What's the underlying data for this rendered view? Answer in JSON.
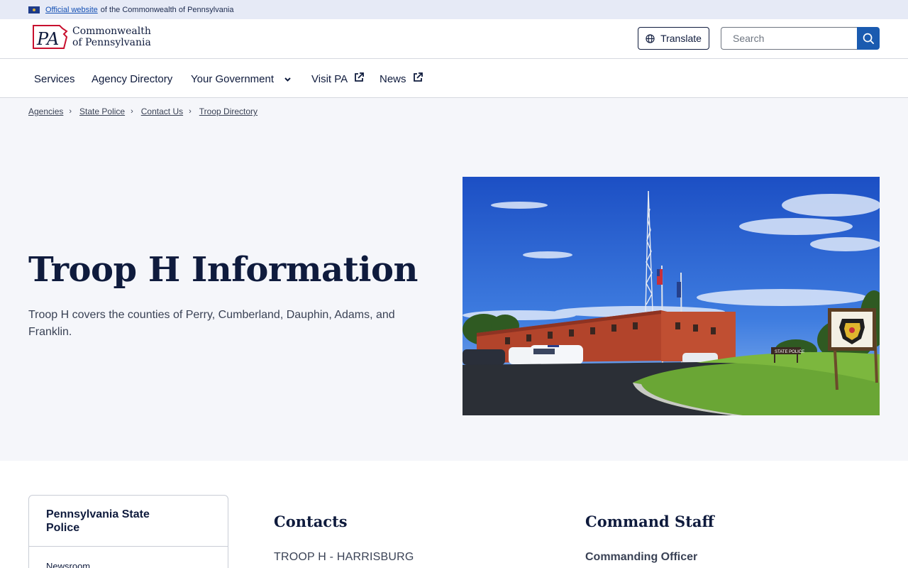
{
  "official_banner": {
    "link_text": "Official website",
    "rest_text": "of the Commonwealth of Pennsylvania"
  },
  "header": {
    "logo_mark": "PA",
    "logo_line1": "Commonwealth",
    "logo_line2": "of Pennsylvania",
    "translate_label": "Translate",
    "search_placeholder": "Search"
  },
  "nav": {
    "items": [
      {
        "label": "Services",
        "external": false,
        "dropdown": false
      },
      {
        "label": "Agency Directory",
        "external": false,
        "dropdown": false
      },
      {
        "label": "Your Government",
        "external": false,
        "dropdown": true
      },
      {
        "label": "Visit PA",
        "external": true,
        "dropdown": false
      },
      {
        "label": "News",
        "external": true,
        "dropdown": false
      }
    ]
  },
  "breadcrumb": [
    "Agencies",
    "State Police",
    "Contact Us",
    "Troop Directory"
  ],
  "hero": {
    "title": "Troop H Information",
    "description": "Troop H covers the counties of Perry, Cumberland, Dauphin, Adams, and Franklin.",
    "image_sign_label": "STATE POLICE"
  },
  "sidebar": {
    "title": "Pennsylvania State Police",
    "items": [
      "Newsroom"
    ]
  },
  "contacts": {
    "heading": "Contacts",
    "first_line": "TROOP H - HARRISBURG"
  },
  "command_staff": {
    "heading": "Command Staff",
    "first_line": "Commanding Officer"
  },
  "colors": {
    "navy": "#0f1b3d",
    "accent_blue": "#1a5bb0",
    "banner_bg": "#e6eaf6",
    "hero_bg": "#f5f6fa",
    "logo_red": "#c8102e"
  }
}
